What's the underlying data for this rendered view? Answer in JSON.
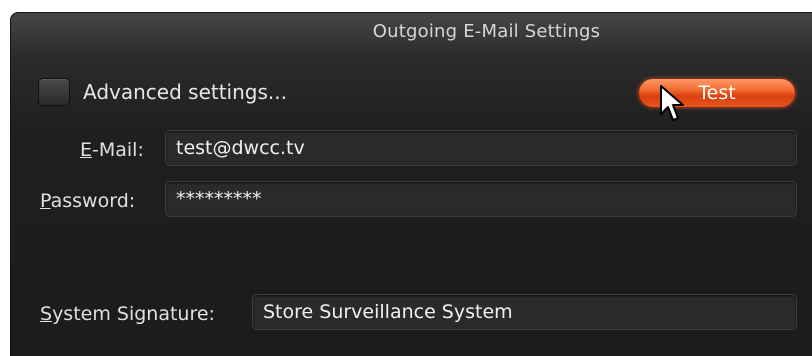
{
  "dialog": {
    "title": "Outgoing E-Mail Settings"
  },
  "advanced": {
    "label": "Advanced settings...",
    "checked": false
  },
  "test_button": {
    "label": "Test",
    "color": "#e8541e"
  },
  "email": {
    "label_mnemonic": "E",
    "label_rest": "-Mail:",
    "value": "test@dwcc.tv"
  },
  "password": {
    "label_mnemonic": "P",
    "label_rest": "assword:",
    "value": "*********"
  },
  "signature": {
    "label_mnemonic": "S",
    "label_rest": "ystem Signature:",
    "value": "Store Surveillance System"
  },
  "icons": {
    "pointer": "arrow-cursor-icon"
  }
}
